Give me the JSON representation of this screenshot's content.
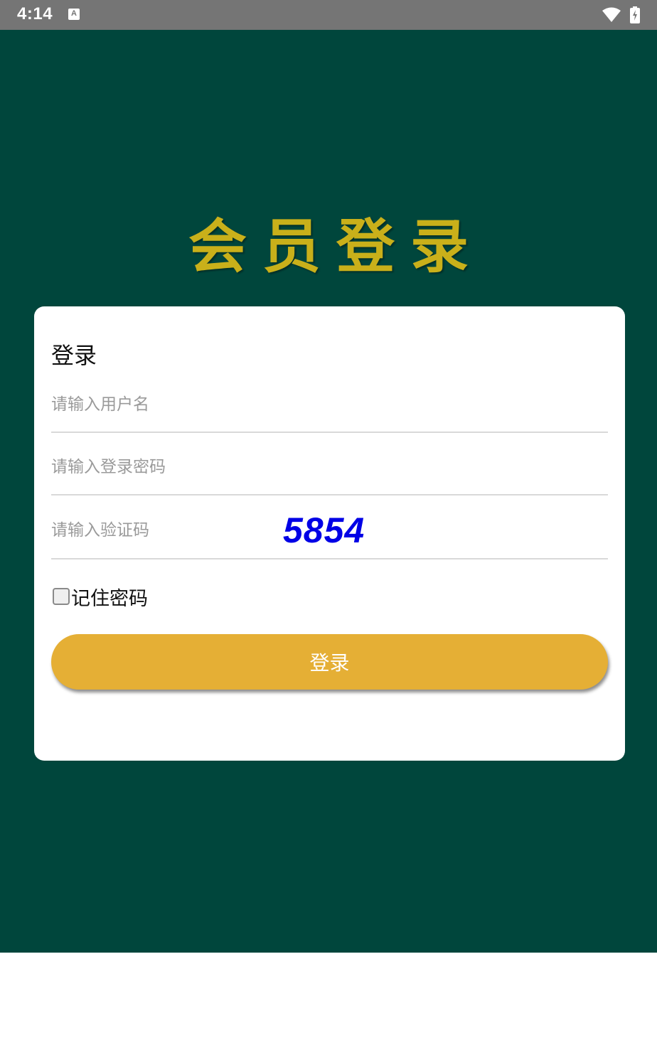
{
  "status_bar": {
    "time": "4:14",
    "notification_icon_letter": "A",
    "icons": [
      "keyboard-a-icon",
      "wifi-icon",
      "battery-charging-icon"
    ]
  },
  "page": {
    "title": "会员登录",
    "background_color": "#00463c",
    "title_color": "#c9b01a"
  },
  "login_card": {
    "heading": "登录",
    "username": {
      "value": "",
      "placeholder": "请输入用户名"
    },
    "password": {
      "value": "",
      "placeholder": "请输入登录密码"
    },
    "captcha": {
      "value": "",
      "placeholder": "请输入验证码",
      "code": "5854",
      "code_color": "#0000e6"
    },
    "remember": {
      "label": "记住密码",
      "checked": false
    },
    "submit_label": "登录",
    "button_color": "#e5af35"
  }
}
